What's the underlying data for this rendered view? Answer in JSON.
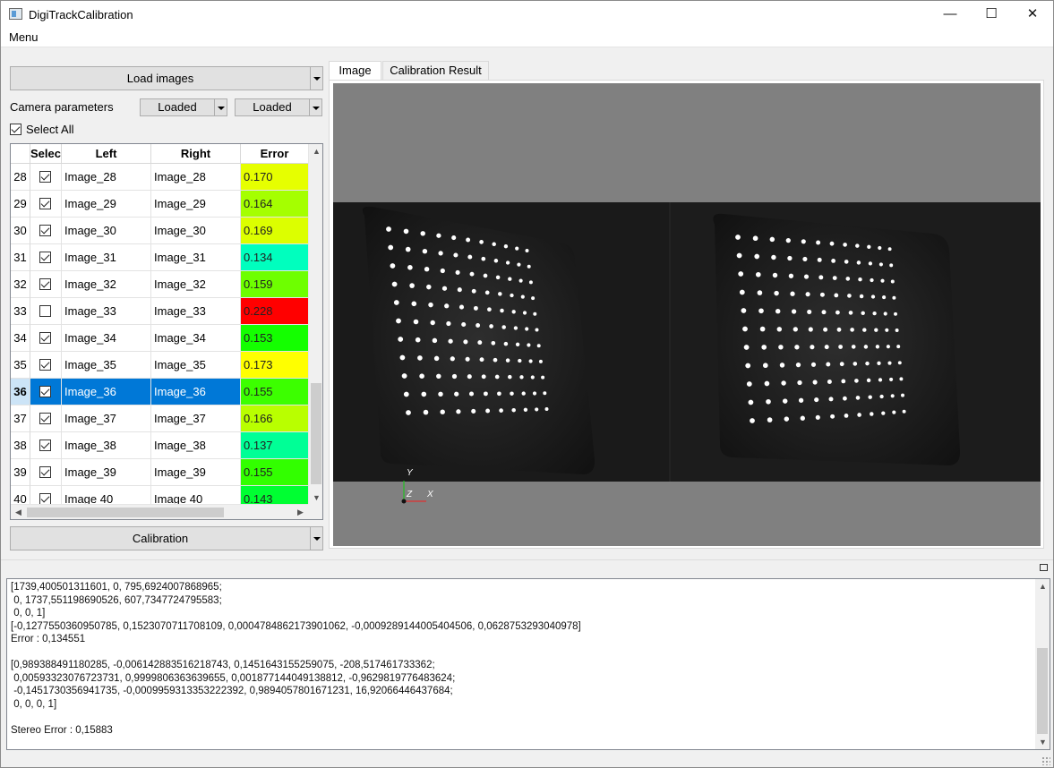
{
  "window": {
    "title": "DigiTrackCalibration",
    "minimize": "—",
    "maximize": "☐",
    "close": "✕"
  },
  "menu": {
    "label": "Menu"
  },
  "left_panel": {
    "load_button": "Load images",
    "camera_params_label": "Camera parameters",
    "left_param_status": "Loaded",
    "right_param_status": "Loaded",
    "select_all_label": "Select All",
    "select_all_checked": true,
    "calibration_button": "Calibration"
  },
  "table": {
    "headers": [
      "",
      "Selec",
      "Left",
      "Right",
      "Error"
    ],
    "rows": [
      {
        "num": "28",
        "checked": true,
        "left": "Image_28",
        "right": "Image_28",
        "error": "0.170",
        "color": "#e6ff00"
      },
      {
        "num": "29",
        "checked": true,
        "left": "Image_29",
        "right": "Image_29",
        "error": "0.164",
        "color": "#a5ff00"
      },
      {
        "num": "30",
        "checked": true,
        "left": "Image_30",
        "right": "Image_30",
        "error": "0.169",
        "color": "#dcff00"
      },
      {
        "num": "31",
        "checked": true,
        "left": "Image_31",
        "right": "Image_31",
        "error": "0.134",
        "color": "#00ffbe"
      },
      {
        "num": "32",
        "checked": true,
        "left": "Image_32",
        "right": "Image_32",
        "error": "0.159",
        "color": "#6eff00"
      },
      {
        "num": "33",
        "checked": false,
        "left": "Image_33",
        "right": "Image_33",
        "error": "0.228",
        "color": "#ff0000"
      },
      {
        "num": "34",
        "checked": true,
        "left": "Image_34",
        "right": "Image_34",
        "error": "0.153",
        "color": "#14ff00"
      },
      {
        "num": "35",
        "checked": true,
        "left": "Image_35",
        "right": "Image_35",
        "error": "0.173",
        "color": "#ffff00"
      },
      {
        "num": "36",
        "checked": true,
        "left": "Image_36",
        "right": "Image_36",
        "error": "0.155",
        "color": "#3cff00",
        "selected": true
      },
      {
        "num": "37",
        "checked": true,
        "left": "Image_37",
        "right": "Image_37",
        "error": "0.166",
        "color": "#b9ff00"
      },
      {
        "num": "38",
        "checked": true,
        "left": "Image_38",
        "right": "Image_38",
        "error": "0.137",
        "color": "#00ff96"
      },
      {
        "num": "39",
        "checked": true,
        "left": "Image_39",
        "right": "Image_39",
        "error": "0.155",
        "color": "#32ff00"
      },
      {
        "num": "40",
        "checked": true,
        "left": "Image 40",
        "right": "Image 40",
        "error": "0.143",
        "color": "#00ff32"
      }
    ]
  },
  "tabs": [
    {
      "label": "Image",
      "active": true
    },
    {
      "label": "Calibration Result",
      "active": false
    }
  ],
  "axes": {
    "y": "Y",
    "z": "Z",
    "x": "X"
  },
  "console": {
    "lines": [
      "[1739,400501311601, 0, 795,6924007868965;",
      " 0, 1737,551198690526, 607,7347724795583;",
      " 0, 0, 1]",
      "[-0,1277550360950785, 0,1523070711708109, 0,000478486217390106​2, -0,0009289144005404506, 0,0628753293040978]",
      "Error : 0,134551",
      "",
      "[0,989388491180285, -0,006142883516218743, 0,1451643155259075, -208,517461733362;",
      " 0,005933230767237​31, 0,9999806363639655, 0,001877144049138812, -0,962981977648362​4;",
      " -0,1451730356941735, -0,0009959313353222392, 0,9894057801671231, 16,92066446437684;",
      " 0, 0, 0, 1]",
      "",
      "Stereo Error : 0,15883"
    ]
  }
}
